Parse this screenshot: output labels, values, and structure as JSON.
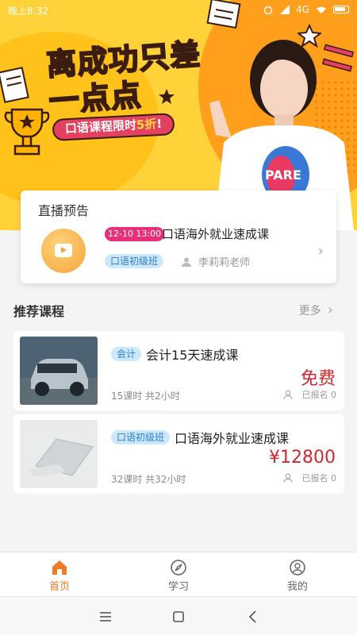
{
  "status_bar": {
    "time": "晚上8:32",
    "network": "4G"
  },
  "banner": {
    "headline_line1": "离成功只差",
    "headline_line2": "一点点",
    "promo_prefix": "口语课程限时",
    "promo_highlight": "5折",
    "promo_suffix": "!",
    "person_shirt_text": "PARE"
  },
  "live_preview": {
    "title": "直播预告",
    "time_badge": "12-10 13:00",
    "course_title": "口语海外就业速成课",
    "tag": "口语初级班",
    "teacher": "李莉莉老师"
  },
  "recommended": {
    "title": "推荐课程",
    "more_label": "更多",
    "courses": [
      {
        "tag": "会计",
        "title": "会计15天速成课",
        "price": "免费",
        "meta": "15课时 共2小时",
        "enrolled": "已报名 0"
      },
      {
        "tag": "口语初级班",
        "title": "口语海外就业速成课",
        "price": "¥12800",
        "meta": "32课时 共32小时",
        "enrolled": "已报名 0"
      }
    ]
  },
  "tabbar": {
    "items": [
      {
        "label": "首页",
        "icon": "home-icon",
        "active": true
      },
      {
        "label": "学习",
        "icon": "compass-icon",
        "active": false
      },
      {
        "label": "我的",
        "icon": "user-icon",
        "active": false
      }
    ]
  },
  "colors": {
    "accent": "#ef7b24",
    "banner_bg": "#ffd23a",
    "price_red": "#d0282e",
    "tag_bg": "#cde8fb",
    "live_badge": "#e8307a"
  }
}
